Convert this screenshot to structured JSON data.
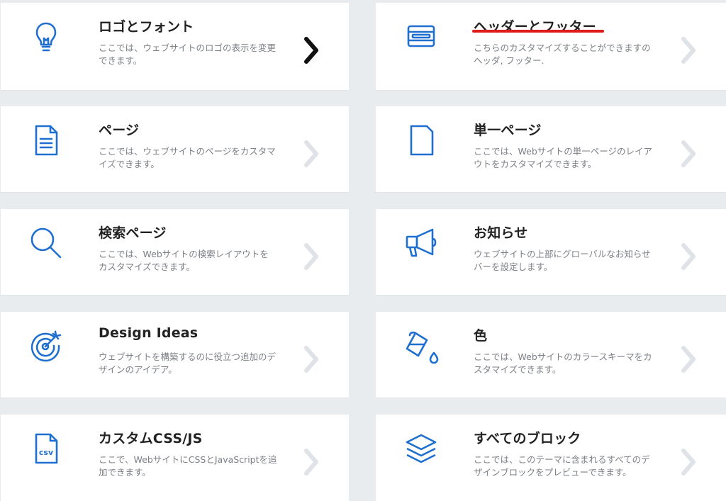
{
  "colors": {
    "accent": "#1f6fd0",
    "chevron_inactive": "#dfe2e6",
    "chevron_active": "#111111",
    "highlight_underline": "#e01b1b"
  },
  "cards": [
    {
      "id": "logo-font",
      "icon": "lightbulb-icon",
      "title": "ロゴとフォント",
      "desc": "ここでは、ウェブサイトのロゴの表示を変更できます。"
    },
    {
      "id": "header-footer",
      "icon": "header-footer-icon",
      "title": "ヘッダーとフッター",
      "desc": "こちらのカスタマイズすることができますのヘッダ, フッター."
    },
    {
      "id": "pages",
      "icon": "document-icon",
      "title": "ページ",
      "desc": "ここでは、ウェブサイトのページをカスタマイズできます。"
    },
    {
      "id": "single-page",
      "icon": "blank-page-icon",
      "title": "単一ページ",
      "desc": "ここでは、Webサイトの単一ページのレイアウトをカスタマイズできます。"
    },
    {
      "id": "search-page",
      "icon": "search-icon",
      "title": "検索ページ",
      "desc": "ここでは、Webサイトの検索レイアウトをカスタマイズできます。"
    },
    {
      "id": "announcement",
      "icon": "megaphone-icon",
      "title": "お知らせ",
      "desc": "ウェブサイトの上部にグローバルなお知らせバーを設定します。"
    },
    {
      "id": "design-ideas",
      "icon": "target-icon",
      "title": "Design Ideas",
      "desc": "ウェブサイトを構築するのに役立つ追加のデザインのアイデア。"
    },
    {
      "id": "colors",
      "icon": "paint-bucket-icon",
      "title": "色",
      "desc": "ここでは、Webサイトのカラースキーマをカスタマイズできます。"
    },
    {
      "id": "custom-css-js",
      "icon": "csv-file-icon",
      "title": "カスタムCSS/JS",
      "desc": "ここで、WebサイトにCSSとJavaScriptを追加できます。"
    },
    {
      "id": "all-blocks",
      "icon": "layers-icon",
      "title": "すべてのブロック",
      "desc": "ここでは、このテーマに含まれるすべてのデザインブロックをプレビューできます。"
    }
  ]
}
